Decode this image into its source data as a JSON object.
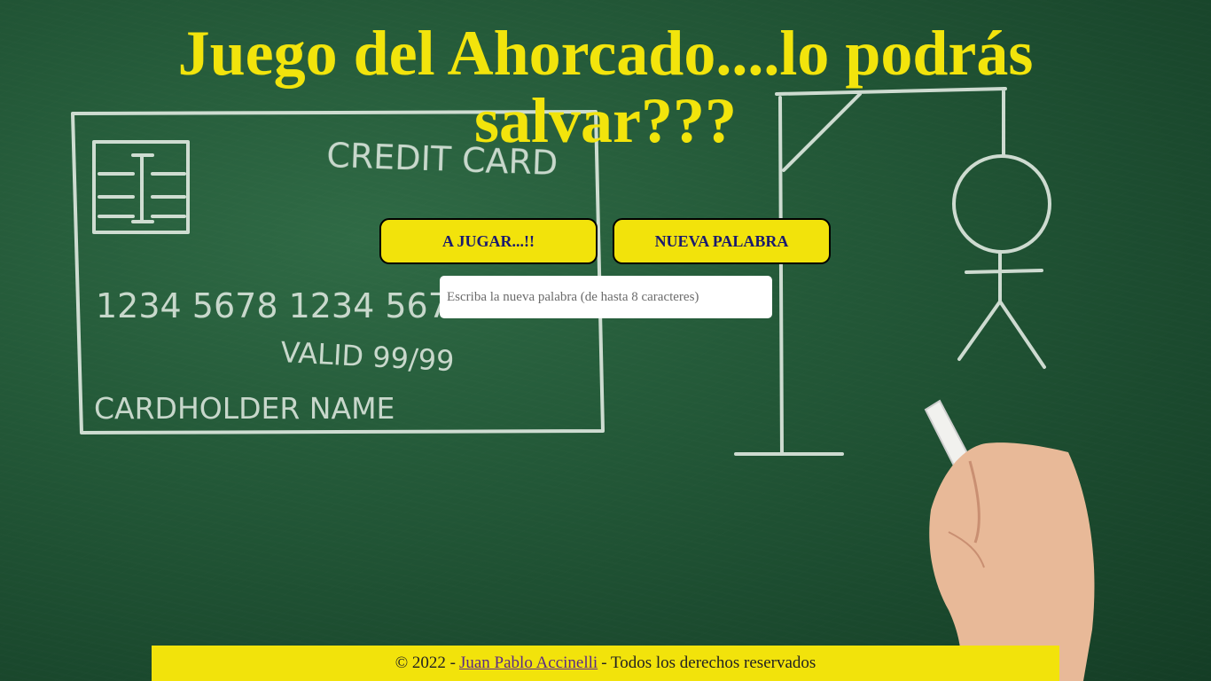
{
  "title": "Juego del Ahorcado....lo podrás salvar???",
  "buttons": {
    "play_label": "A JUGAR...!!",
    "new_word_label": "NUEVA PALABRA"
  },
  "word_input": {
    "placeholder": "Escriba la nueva palabra (de hasta 8 caracteres)",
    "value": ""
  },
  "background_chalk": {
    "card_title": "CREDIT CARD",
    "card_number": "1234 5678 1234 5678",
    "valid": "VALID 99/99",
    "holder": "CARDHOLDER NAME"
  },
  "footer": {
    "prefix": "© 2022 -",
    "author_link": "Juan Pablo Accinelli",
    "suffix": "- Todos los derechos reservados"
  },
  "colors": {
    "accent_yellow": "#f2e30b",
    "title_yellow": "#f2e40c",
    "button_text": "#1a1a6e",
    "link": "#5a2a86",
    "chalkboard": "#245a39"
  }
}
